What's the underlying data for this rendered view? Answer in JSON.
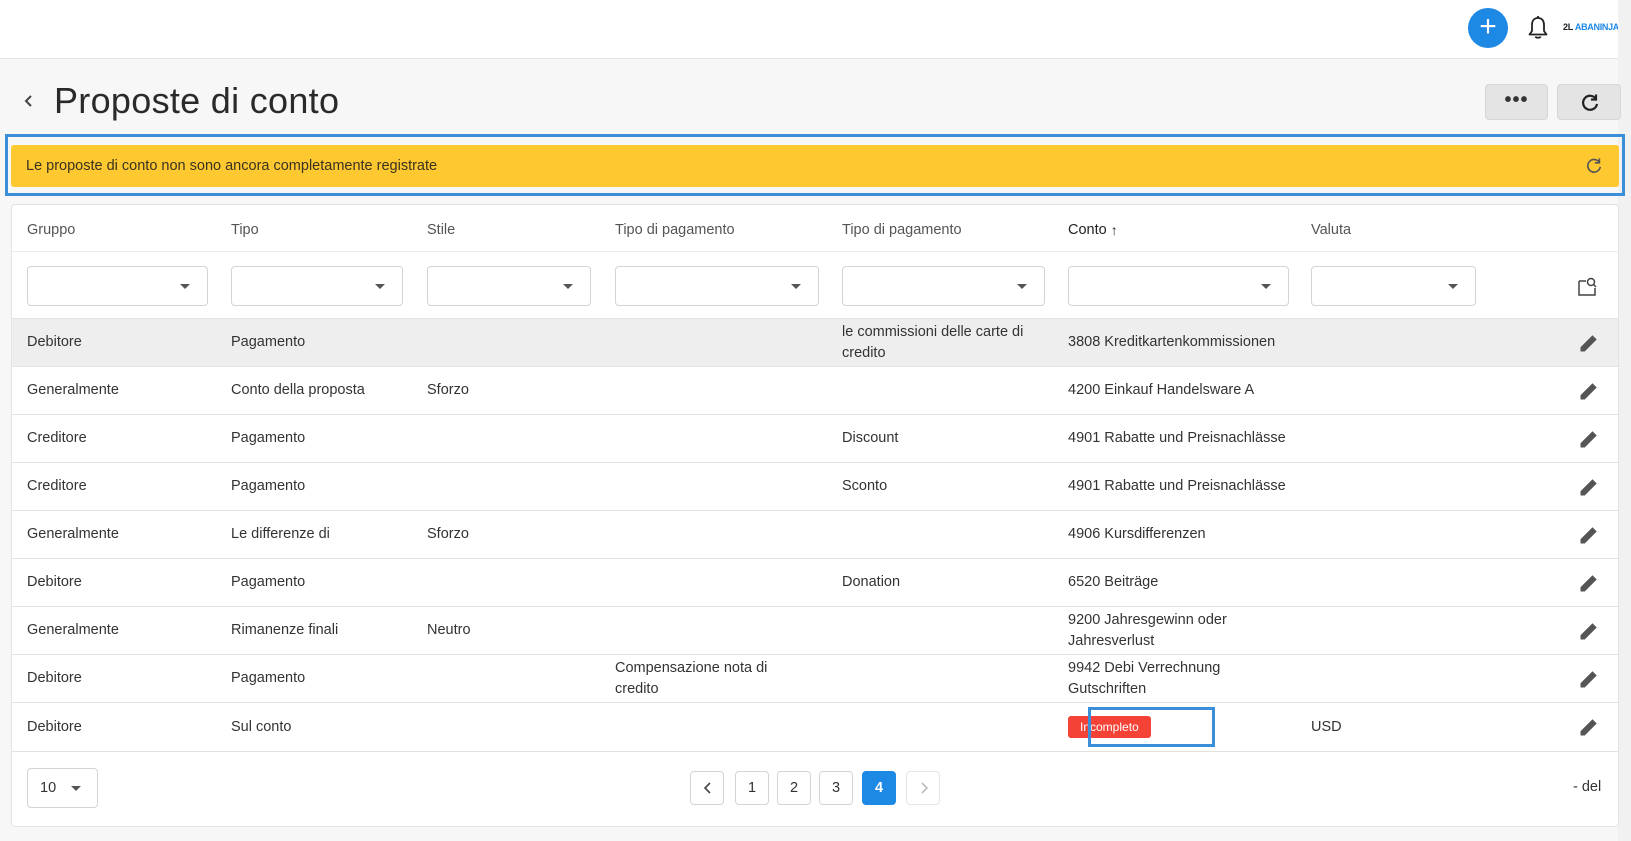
{
  "header": {
    "logo_text": "ABANINJA",
    "logo_mark": "2L"
  },
  "page": {
    "title": "Proposte di conto",
    "more_label": "•••"
  },
  "banner": {
    "text": "Le proposte di conto non sono ancora completamente registrate",
    "color": "#fec831"
  },
  "table": {
    "columns": [
      "Gruppo",
      "Tipo",
      "Stile",
      "Tipo di pagamento",
      "Tipo di pagamento",
      "Conto",
      "Valuta"
    ],
    "sorted_column": "Conto",
    "sort_direction": "ascending",
    "rows": [
      {
        "gruppo": "Debitore",
        "tipo": "Pagamento",
        "stile": "",
        "tipo_pagamento_1": "",
        "tipo_pagamento_2": "le commissioni delle carte di credito",
        "conto": "3808 Kreditkartenkommissionen",
        "valuta": ""
      },
      {
        "gruppo": "Generalmente",
        "tipo": "Conto della proposta",
        "stile": "Sforzo",
        "tipo_pagamento_1": "",
        "tipo_pagamento_2": "",
        "conto": "4200 Einkauf Handelsware A",
        "valuta": ""
      },
      {
        "gruppo": "Creditore",
        "tipo": "Pagamento",
        "stile": "",
        "tipo_pagamento_1": "",
        "tipo_pagamento_2": "Discount",
        "conto": "4901 Rabatte und Preisnachlässe",
        "valuta": ""
      },
      {
        "gruppo": "Creditore",
        "tipo": "Pagamento",
        "stile": "",
        "tipo_pagamento_1": "",
        "tipo_pagamento_2": "Sconto",
        "conto": "4901 Rabatte und Preisnachlässe",
        "valuta": ""
      },
      {
        "gruppo": "Generalmente",
        "tipo": "Le differenze di",
        "stile": "Sforzo",
        "tipo_pagamento_1": "",
        "tipo_pagamento_2": "",
        "conto": "4906 Kursdifferenzen",
        "valuta": ""
      },
      {
        "gruppo": "Debitore",
        "tipo": "Pagamento",
        "stile": "",
        "tipo_pagamento_1": "",
        "tipo_pagamento_2": "Donation",
        "conto": "6520 Beiträge",
        "valuta": ""
      },
      {
        "gruppo": "Generalmente",
        "tipo": "Rimanenze finali",
        "stile": "Neutro",
        "tipo_pagamento_1": "",
        "tipo_pagamento_2": "",
        "conto": "9200 Jahresgewinn oder Jahresverlust",
        "valuta": ""
      },
      {
        "gruppo": "Debitore",
        "tipo": "Pagamento",
        "stile": "",
        "tipo_pagamento_1": "Compensazione nota di credito",
        "tipo_pagamento_2": "",
        "conto": "9942 Debi Verrechnung Gutschriften",
        "valuta": ""
      },
      {
        "gruppo": "Debitore",
        "tipo": "Sul conto",
        "stile": "",
        "tipo_pagamento_1": "",
        "tipo_pagamento_2": "",
        "conto": "",
        "conto_badge": "Incompleto",
        "valuta": "USD"
      }
    ]
  },
  "pagination": {
    "page_size": "10",
    "pages": [
      "1",
      "2",
      "3",
      "4"
    ],
    "current_page": "4",
    "range_text": "- del"
  },
  "colors": {
    "accent": "#1e88e5",
    "badge_error": "#f44336",
    "warning": "#fec831"
  }
}
